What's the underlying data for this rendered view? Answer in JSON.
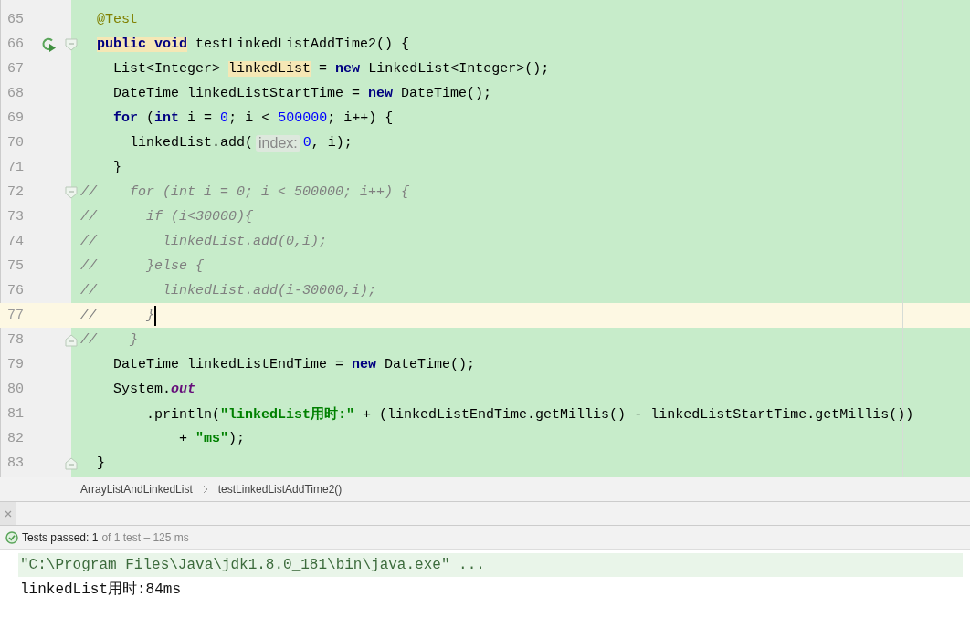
{
  "editor": {
    "lines": [
      {
        "number": "65",
        "current": false,
        "run_marker": false,
        "fold_start": false,
        "fold_end": false,
        "tokens": [
          {
            "kind": "annotation",
            "text": "  @Test"
          }
        ]
      },
      {
        "number": "66",
        "current": false,
        "run_marker": true,
        "fold_start": true,
        "fold_end": false,
        "tokens": [
          {
            "kind": "keyword",
            "text": "  public void",
            "highlighted": true
          },
          {
            "kind": "plain",
            "text": " testLinkedListAddTime2() {"
          }
        ]
      },
      {
        "number": "67",
        "current": false,
        "run_marker": false,
        "fold_start": false,
        "fold_end": false,
        "tokens": [
          {
            "kind": "plain",
            "text": "    List<Integer> "
          },
          {
            "kind": "plain",
            "text": "linkedList",
            "highlighted": true
          },
          {
            "kind": "plain",
            "text": " = "
          },
          {
            "kind": "keyword",
            "text": "new"
          },
          {
            "kind": "plain",
            "text": " LinkedList<Integer>();"
          }
        ]
      },
      {
        "number": "68",
        "current": false,
        "run_marker": false,
        "fold_start": false,
        "fold_end": false,
        "tokens": [
          {
            "kind": "plain",
            "text": "    DateTime linkedListStartTime = "
          },
          {
            "kind": "keyword",
            "text": "new"
          },
          {
            "kind": "plain",
            "text": " DateTime();"
          }
        ]
      },
      {
        "number": "69",
        "current": false,
        "run_marker": false,
        "fold_start": false,
        "fold_end": false,
        "tokens": [
          {
            "kind": "keyword",
            "text": "    for"
          },
          {
            "kind": "plain",
            "text": " ("
          },
          {
            "kind": "keyword",
            "text": "int"
          },
          {
            "kind": "plain",
            "text": " i = "
          },
          {
            "kind": "number",
            "text": "0"
          },
          {
            "kind": "plain",
            "text": "; i < "
          },
          {
            "kind": "number",
            "text": "500000"
          },
          {
            "kind": "plain",
            "text": "; i++) {"
          }
        ]
      },
      {
        "number": "70",
        "current": false,
        "run_marker": false,
        "fold_start": false,
        "fold_end": false,
        "tokens": [
          {
            "kind": "plain",
            "text": "      linkedList.add("
          },
          {
            "kind": "hint",
            "text": "index:"
          },
          {
            "kind": "number",
            "text": "0"
          },
          {
            "kind": "plain",
            "text": ", i);"
          }
        ]
      },
      {
        "number": "71",
        "current": false,
        "run_marker": false,
        "fold_start": false,
        "fold_end": false,
        "tokens": [
          {
            "kind": "plain",
            "text": "    }"
          }
        ]
      },
      {
        "number": "72",
        "current": false,
        "run_marker": false,
        "fold_start": true,
        "fold_end": false,
        "tokens": [
          {
            "kind": "comment",
            "text": "//    for (int i = 0; i < 500000; i++) {"
          }
        ]
      },
      {
        "number": "73",
        "current": false,
        "run_marker": false,
        "fold_start": false,
        "fold_end": false,
        "tokens": [
          {
            "kind": "comment",
            "text": "//      if (i<30000){"
          }
        ]
      },
      {
        "number": "74",
        "current": false,
        "run_marker": false,
        "fold_start": false,
        "fold_end": false,
        "tokens": [
          {
            "kind": "comment",
            "text": "//        linkedList.add(0,i);"
          }
        ]
      },
      {
        "number": "75",
        "current": false,
        "run_marker": false,
        "fold_start": false,
        "fold_end": false,
        "tokens": [
          {
            "kind": "comment",
            "text": "//      }else {"
          }
        ]
      },
      {
        "number": "76",
        "current": false,
        "run_marker": false,
        "fold_start": false,
        "fold_end": false,
        "tokens": [
          {
            "kind": "comment",
            "text": "//        linkedList.add(i-30000,i);"
          }
        ]
      },
      {
        "number": "77",
        "current": true,
        "run_marker": false,
        "fold_start": false,
        "fold_end": false,
        "tokens": [
          {
            "kind": "comment",
            "text": "//      }"
          }
        ]
      },
      {
        "number": "78",
        "current": false,
        "run_marker": false,
        "fold_start": false,
        "fold_end": true,
        "tokens": [
          {
            "kind": "comment",
            "text": "//    }"
          }
        ]
      },
      {
        "number": "79",
        "current": false,
        "run_marker": false,
        "fold_start": false,
        "fold_end": false,
        "tokens": [
          {
            "kind": "plain",
            "text": "    DateTime linkedListEndTime = "
          },
          {
            "kind": "keyword",
            "text": "new"
          },
          {
            "kind": "plain",
            "text": " DateTime();"
          }
        ]
      },
      {
        "number": "80",
        "current": false,
        "run_marker": false,
        "fold_start": false,
        "fold_end": false,
        "tokens": [
          {
            "kind": "plain",
            "text": "    System."
          },
          {
            "kind": "field",
            "text": "out"
          }
        ]
      },
      {
        "number": "81",
        "current": false,
        "run_marker": false,
        "fold_start": false,
        "fold_end": false,
        "tokens": [
          {
            "kind": "plain",
            "text": "        .println("
          },
          {
            "kind": "string",
            "text": "\"linkedList用时:\""
          },
          {
            "kind": "plain",
            "text": " + (linkedListEndTime.getMillis() - linkedListStartTime.getMillis())"
          }
        ]
      },
      {
        "number": "82",
        "current": false,
        "run_marker": false,
        "fold_start": false,
        "fold_end": false,
        "tokens": [
          {
            "kind": "plain",
            "text": "            + "
          },
          {
            "kind": "string",
            "text": "\"ms\""
          },
          {
            "kind": "plain",
            "text": ");"
          }
        ]
      },
      {
        "number": "83",
        "current": false,
        "run_marker": false,
        "fold_start": false,
        "fold_end": true,
        "tokens": [
          {
            "kind": "plain",
            "text": "  }"
          }
        ]
      }
    ]
  },
  "breadcrumb": [
    "ArrayListAndLinkedList",
    "testLinkedListAddTime2()"
  ],
  "run_panel": {
    "status": {
      "passed": true,
      "label": "Tests passed: 1",
      "detail": "of 1 test – 125 ms"
    },
    "console": [
      {
        "kind": "command",
        "text": "\"C:\\Program Files\\Java\\jdk1.8.0_181\\bin\\java.exe\" ..."
      },
      {
        "kind": "output",
        "text": "linkedList用时:84ms"
      }
    ]
  }
}
